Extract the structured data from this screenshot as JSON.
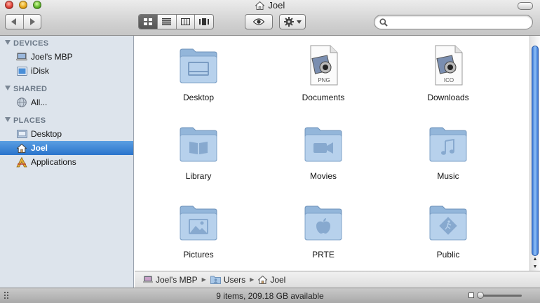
{
  "window": {
    "title": "Joel"
  },
  "toolbar": {
    "back_icon": "chevron-left-icon",
    "forward_icon": "chevron-right-icon",
    "views": [
      "icon-view-icon",
      "list-view-icon",
      "column-view-icon",
      "coverflow-view-icon"
    ],
    "quicklook_icon": "eye-icon",
    "action_icon": "gear-icon",
    "search": {
      "placeholder": "",
      "value": ""
    }
  },
  "sidebar": {
    "sections": [
      {
        "title": "DEVICES",
        "items": [
          {
            "label": "Joel's MBP",
            "icon": "laptop-icon"
          },
          {
            "label": "iDisk",
            "icon": "idisk-icon"
          }
        ]
      },
      {
        "title": "SHARED",
        "items": [
          {
            "label": "All...",
            "icon": "network-globe-icon"
          }
        ]
      },
      {
        "title": "PLACES",
        "items": [
          {
            "label": "Desktop",
            "icon": "desktop-icon"
          },
          {
            "label": "Joel",
            "icon": "home-icon",
            "selected": true
          },
          {
            "label": "Applications",
            "icon": "applications-icon"
          }
        ]
      }
    ]
  },
  "files": [
    {
      "label": "Desktop",
      "icon": "desktop-folder-icon"
    },
    {
      "label": "Documents",
      "icon": "png-file-icon",
      "badge": "PNG"
    },
    {
      "label": "Downloads",
      "icon": "ico-file-icon",
      "badge": "ICO"
    },
    {
      "label": "Library",
      "icon": "library-folder-icon"
    },
    {
      "label": "Movies",
      "icon": "movies-folder-icon"
    },
    {
      "label": "Music",
      "icon": "music-folder-icon"
    },
    {
      "label": "Pictures",
      "icon": "pictures-folder-icon"
    },
    {
      "label": "PRTE",
      "icon": "apple-folder-icon"
    },
    {
      "label": "Public",
      "icon": "public-folder-icon"
    }
  ],
  "pathbar": [
    {
      "label": "Joel's MBP",
      "icon": "laptop-icon"
    },
    {
      "label": "Users",
      "icon": "folder-icon"
    },
    {
      "label": "Joel",
      "icon": "home-icon"
    }
  ],
  "status": {
    "text": "9 items, 209.18 GB available"
  },
  "colors": {
    "selection": "#2a74cc",
    "folder": "#a9c8e8",
    "sidebar": "#dde4ec"
  }
}
